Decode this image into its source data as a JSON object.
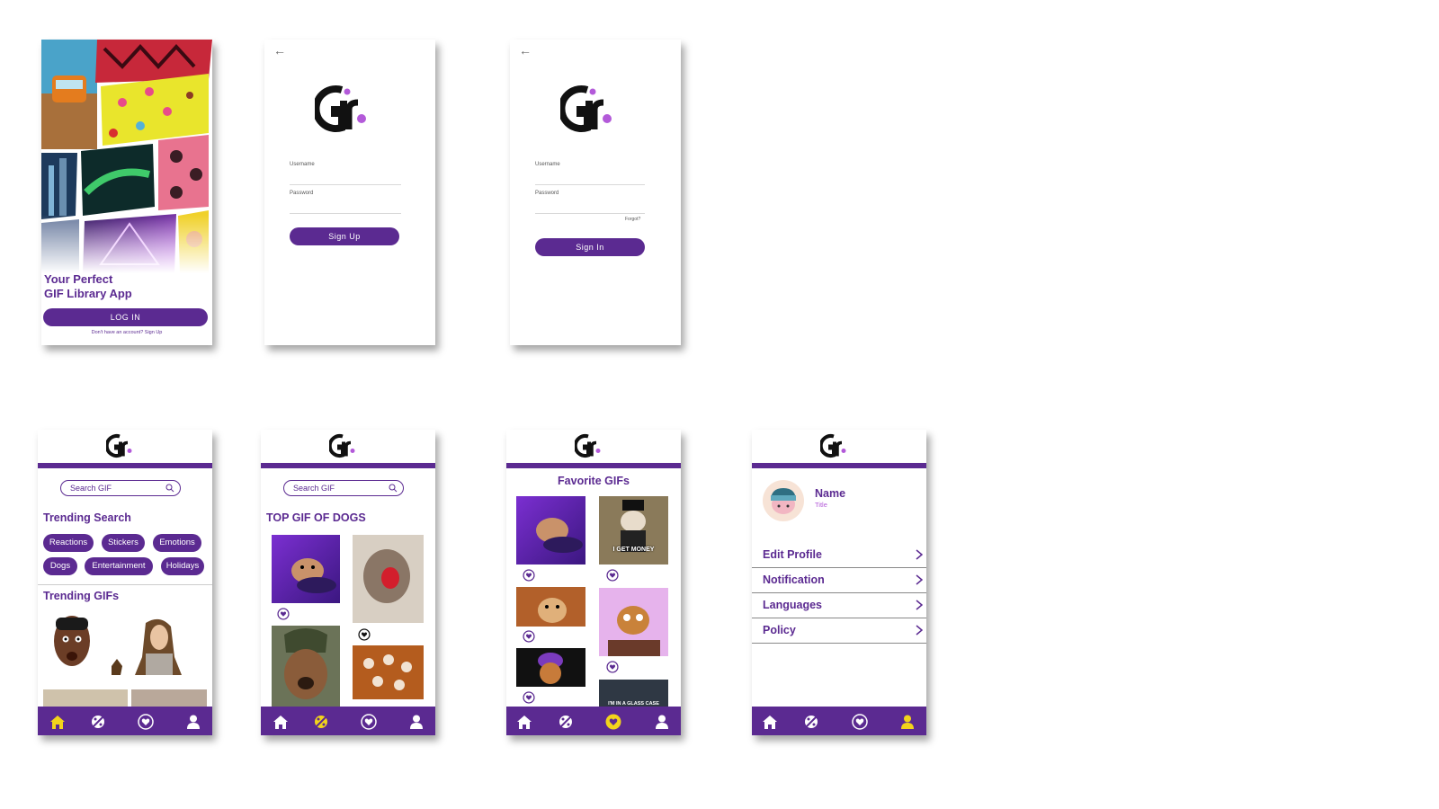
{
  "welcome": {
    "headline_line1": "Your Perfect",
    "headline_line2": "GIF Library App",
    "login_button": "LOG IN",
    "signup_prompt": "Don't have an account? Sign Up"
  },
  "signup": {
    "back": "←",
    "username_label": "Username",
    "password_label": "Password",
    "button": "Sign Up"
  },
  "signin": {
    "back": "←",
    "username_label": "Username",
    "password_label": "Password",
    "forgot": "Forgot?",
    "button": "Sign In"
  },
  "home": {
    "search_placeholder": "Search GIF",
    "trending_search_title": "Trending Search",
    "chips": [
      "Reactions",
      "Stickers",
      "Emotions",
      "Dogs",
      "Entertainment",
      "Holidays"
    ],
    "trending_gifs_title": "Trending GIFs"
  },
  "category": {
    "search_placeholder": "Search GIF",
    "title": "TOP GIF OF DOGS"
  },
  "favorites": {
    "title": "Favorite GIFs",
    "caption_money": "I GET MONEY",
    "caption_glass": "I'M IN A GLASS CASE"
  },
  "profile": {
    "name": "Name",
    "subtitle": "Title",
    "menu": [
      "Edit Profile",
      "Notification",
      "Languages",
      "Policy"
    ]
  },
  "nav_icons": [
    "home-icon",
    "explore-icon",
    "favorites-icon",
    "profile-icon"
  ],
  "colors": {
    "brand_purple": "#5b2a91",
    "accent_pink": "#b35ad9",
    "active_yellow": "#f2d41b"
  }
}
